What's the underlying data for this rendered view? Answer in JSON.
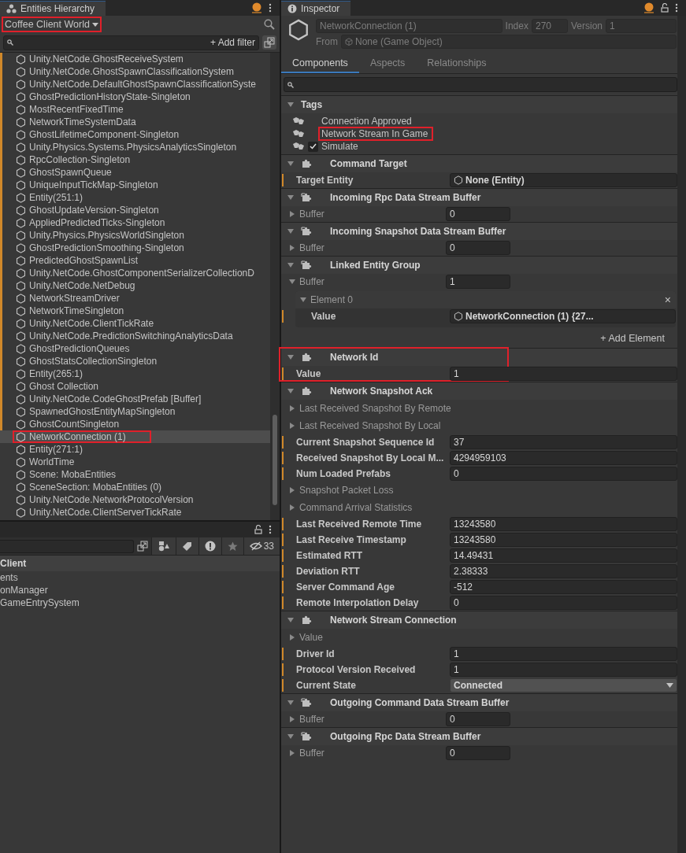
{
  "hierarchy": {
    "tab": "Entities Hierarchy",
    "world": "Coffee Client World",
    "world_highlighted": true,
    "add_filter": "+ Add filter",
    "items": [
      {
        "label": "Unity.NetCode.GhostReceiveSystem",
        "marked": true,
        "selected": false,
        "highlighted": false
      },
      {
        "label": "Unity.NetCode.GhostSpawnClassificationSystem",
        "marked": true,
        "selected": false,
        "highlighted": false
      },
      {
        "label": "Unity.NetCode.DefaultGhostSpawnClassificationSyste",
        "marked": true,
        "selected": false,
        "highlighted": false
      },
      {
        "label": "GhostPredictionHistoryState-Singleton",
        "marked": true,
        "selected": false,
        "highlighted": false
      },
      {
        "label": "MostRecentFixedTime",
        "marked": true,
        "selected": false,
        "highlighted": false
      },
      {
        "label": "NetworkTimeSystemData",
        "marked": true,
        "selected": false,
        "highlighted": false
      },
      {
        "label": "GhostLifetimeComponent-Singleton",
        "marked": true,
        "selected": false,
        "highlighted": false
      },
      {
        "label": "Unity.Physics.Systems.PhysicsAnalyticsSingleton",
        "marked": true,
        "selected": false,
        "highlighted": false
      },
      {
        "label": "RpcCollection-Singleton",
        "marked": true,
        "selected": false,
        "highlighted": false
      },
      {
        "label": "GhostSpawnQueue",
        "marked": true,
        "selected": false,
        "highlighted": false
      },
      {
        "label": "UniqueInputTickMap-Singleton",
        "marked": true,
        "selected": false,
        "highlighted": false
      },
      {
        "label": "Entity(251:1)",
        "marked": true,
        "selected": false,
        "highlighted": false
      },
      {
        "label": "GhostUpdateVersion-Singleton",
        "marked": true,
        "selected": false,
        "highlighted": false
      },
      {
        "label": "AppliedPredictedTicks-Singleton",
        "marked": true,
        "selected": false,
        "highlighted": false
      },
      {
        "label": "Unity.Physics.PhysicsWorldSingleton",
        "marked": true,
        "selected": false,
        "highlighted": false
      },
      {
        "label": "GhostPredictionSmoothing-Singleton",
        "marked": true,
        "selected": false,
        "highlighted": false
      },
      {
        "label": "PredictedGhostSpawnList",
        "marked": true,
        "selected": false,
        "highlighted": false
      },
      {
        "label": "Unity.NetCode.GhostComponentSerializerCollectionD",
        "marked": true,
        "selected": false,
        "highlighted": false
      },
      {
        "label": "Unity.NetCode.NetDebug",
        "marked": true,
        "selected": false,
        "highlighted": false
      },
      {
        "label": "NetworkStreamDriver",
        "marked": true,
        "selected": false,
        "highlighted": false
      },
      {
        "label": "NetworkTimeSingleton",
        "marked": true,
        "selected": false,
        "highlighted": false
      },
      {
        "label": "Unity.NetCode.ClientTickRate",
        "marked": true,
        "selected": false,
        "highlighted": false
      },
      {
        "label": "Unity.NetCode.PredictionSwitchingAnalyticsData",
        "marked": true,
        "selected": false,
        "highlighted": false
      },
      {
        "label": "GhostPredictionQueues",
        "marked": true,
        "selected": false,
        "highlighted": false
      },
      {
        "label": "GhostStatsCollectionSingleton",
        "marked": true,
        "selected": false,
        "highlighted": false
      },
      {
        "label": "Entity(265:1)",
        "marked": true,
        "selected": false,
        "highlighted": false
      },
      {
        "label": "Ghost Collection",
        "marked": true,
        "selected": false,
        "highlighted": false
      },
      {
        "label": "Unity.NetCode.CodeGhostPrefab [Buffer]",
        "marked": true,
        "selected": false,
        "highlighted": false
      },
      {
        "label": "SpawnedGhostEntityMapSingleton",
        "marked": true,
        "selected": false,
        "highlighted": false
      },
      {
        "label": "GhostCountSingleton",
        "marked": true,
        "selected": false,
        "highlighted": false
      },
      {
        "label": "NetworkConnection (1)",
        "marked": false,
        "selected": true,
        "highlighted": true
      },
      {
        "label": "Entity(271:1)",
        "marked": false,
        "selected": false,
        "highlighted": false
      },
      {
        "label": "WorldTime",
        "marked": false,
        "selected": false,
        "highlighted": false
      },
      {
        "label": "Scene: MobaEntities",
        "marked": false,
        "selected": false,
        "highlighted": false
      },
      {
        "label": "SceneSection: MobaEntities (0)",
        "marked": false,
        "selected": false,
        "highlighted": false
      },
      {
        "label": "Unity.NetCode.NetworkProtocolVersion",
        "marked": false,
        "selected": false,
        "highlighted": false
      },
      {
        "label": "Unity.NetCode.ClientServerTickRate",
        "marked": false,
        "selected": false,
        "highlighted": false
      }
    ]
  },
  "systems": {
    "count": "33",
    "rows": [
      {
        "label": "Client",
        "kind": "header"
      },
      {
        "label": "ents",
        "kind": "item"
      },
      {
        "label": "onManager",
        "kind": "item"
      },
      {
        "label": "GameEntrySystem",
        "kind": "item"
      }
    ]
  },
  "inspector": {
    "tab": "Inspector",
    "entity_name": "NetworkConnection (1)",
    "index_label": "Index",
    "index": "270",
    "version_label": "Version",
    "version": "1",
    "from_label": "From",
    "from": "None (Game Object)",
    "tabs": [
      {
        "label": "Components",
        "selected": true
      },
      {
        "label": "Aspects",
        "selected": false
      },
      {
        "label": "Relationships",
        "selected": false
      }
    ],
    "tags": {
      "title": "Tags",
      "items": [
        {
          "label": "Connection Approved",
          "checked": false,
          "highlighted": false
        },
        {
          "label": "Network Stream In Game",
          "checked": false,
          "highlighted": true
        },
        {
          "label": "Simulate",
          "checked": true,
          "highlighted": false
        }
      ]
    },
    "components": [
      {
        "title": "Command Target",
        "kind": "component",
        "highlighted": false,
        "rows": [
          {
            "kind": "entity-field",
            "label": "Target Entity",
            "value": "None (Entity)",
            "marked": true
          }
        ]
      },
      {
        "title": "Incoming Rpc Data Stream Buffer",
        "kind": "buffer",
        "highlighted": false,
        "rows": [
          {
            "kind": "buffer",
            "label": "Buffer",
            "value": "0",
            "expanded": false
          }
        ]
      },
      {
        "title": "Incoming Snapshot Data Stream Buffer",
        "kind": "buffer",
        "highlighted": false,
        "rows": [
          {
            "kind": "buffer",
            "label": "Buffer",
            "value": "0",
            "expanded": false
          }
        ]
      },
      {
        "title": "Linked Entity Group",
        "kind": "buffer",
        "highlighted": false,
        "rows": [
          {
            "kind": "buffer",
            "label": "Buffer",
            "value": "1",
            "expanded": true
          },
          {
            "kind": "element",
            "label": "Element 0",
            "close": "×",
            "rows": [
              {
                "kind": "entity-field",
                "label": "Value",
                "value": "NetworkConnection (1) {27...",
                "marked": true
              }
            ]
          },
          {
            "kind": "add",
            "label": "+ Add Element"
          }
        ]
      },
      {
        "title": "Network Id",
        "kind": "component",
        "highlighted": true,
        "rows": [
          {
            "kind": "field",
            "label": "Value",
            "value": "1",
            "marked": true
          }
        ]
      },
      {
        "title": "Network Snapshot Ack",
        "kind": "component",
        "highlighted": false,
        "rows": [
          {
            "kind": "foldout",
            "label": "Last Received Snapshot By Remote"
          },
          {
            "kind": "foldout",
            "label": "Last Received Snapshot By Local"
          },
          {
            "kind": "field",
            "label": "Current Snapshot Sequence Id",
            "value": "37",
            "marked": true
          },
          {
            "kind": "field",
            "label": "Received Snapshot By Local M...",
            "value": "4294959103",
            "marked": true
          },
          {
            "kind": "field",
            "label": "Num Loaded Prefabs",
            "value": "0",
            "marked": true
          },
          {
            "kind": "foldout",
            "label": "Snapshot Packet Loss"
          },
          {
            "kind": "foldout",
            "label": "Command Arrival Statistics"
          },
          {
            "kind": "field",
            "label": "Last Received Remote Time",
            "value": "13243580",
            "marked": true
          },
          {
            "kind": "field",
            "label": "Last Receive Timestamp",
            "value": "13243580",
            "marked": true
          },
          {
            "kind": "field",
            "label": "Estimated RTT",
            "value": "14.49431",
            "marked": true
          },
          {
            "kind": "field",
            "label": "Deviation RTT",
            "value": "2.38333",
            "marked": true
          },
          {
            "kind": "field",
            "label": "Server Command Age",
            "value": "-512",
            "marked": true
          },
          {
            "kind": "field",
            "label": "Remote Interpolation Delay",
            "value": "0",
            "marked": true
          }
        ]
      },
      {
        "title": "Network Stream Connection",
        "kind": "component",
        "highlighted": false,
        "rows": [
          {
            "kind": "foldout",
            "label": "Value"
          },
          {
            "kind": "field",
            "label": "Driver Id",
            "value": "1",
            "marked": true
          },
          {
            "kind": "field",
            "label": "Protocol Version Received",
            "value": "1",
            "marked": true
          },
          {
            "kind": "dropdown",
            "label": "Current State",
            "value": "Connected",
            "marked": true
          }
        ]
      },
      {
        "title": "Outgoing Command Data Stream Buffer",
        "kind": "buffer",
        "highlighted": false,
        "rows": [
          {
            "kind": "buffer",
            "label": "Buffer",
            "value": "0",
            "expanded": false
          }
        ]
      },
      {
        "title": "Outgoing Rpc Data Stream Buffer",
        "kind": "buffer",
        "highlighted": false,
        "rows": [
          {
            "kind": "buffer",
            "label": "Buffer",
            "value": "0",
            "expanded": false
          }
        ]
      }
    ]
  }
}
